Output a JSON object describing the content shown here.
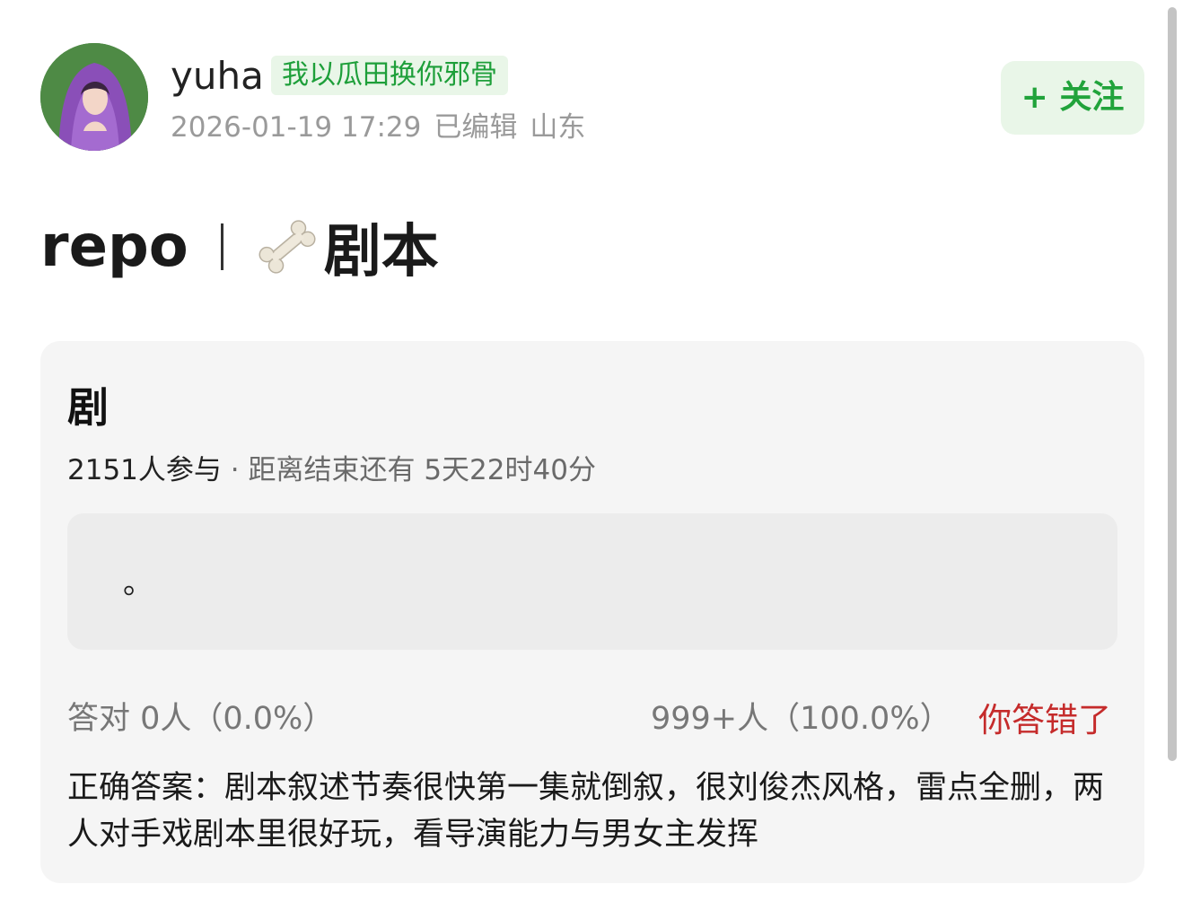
{
  "header": {
    "username": "yuha",
    "user_tag": "我以瓜田换你邪骨",
    "timestamp": "2026-01-19 17:29",
    "edited": "已编辑",
    "location": "山东",
    "follow_label": "+ 关注"
  },
  "post": {
    "title_left": "repo",
    "title_right": "剧本",
    "title_icon": "bone-icon"
  },
  "poll": {
    "question": "剧",
    "participants": "2151人参与",
    "dot": "·",
    "deadline": "距离结束还有 5天22时40分",
    "option_text": "。",
    "correct_stat": "答对  0人（0.0%）",
    "wrong_stat": "999+人（100.0%）",
    "wrong_label": "你答错了",
    "answer": "正确答案：剧本叙述节奏很快第一集就倒叙，很刘俊杰风格，雷点全删，两人对手戏剧本里很好玩，看导演能力与男女主发挥"
  },
  "colors": {
    "accent_green": "#21a33b",
    "tag_bg": "#e9f6e8",
    "wrong_red": "#c52b2b"
  }
}
